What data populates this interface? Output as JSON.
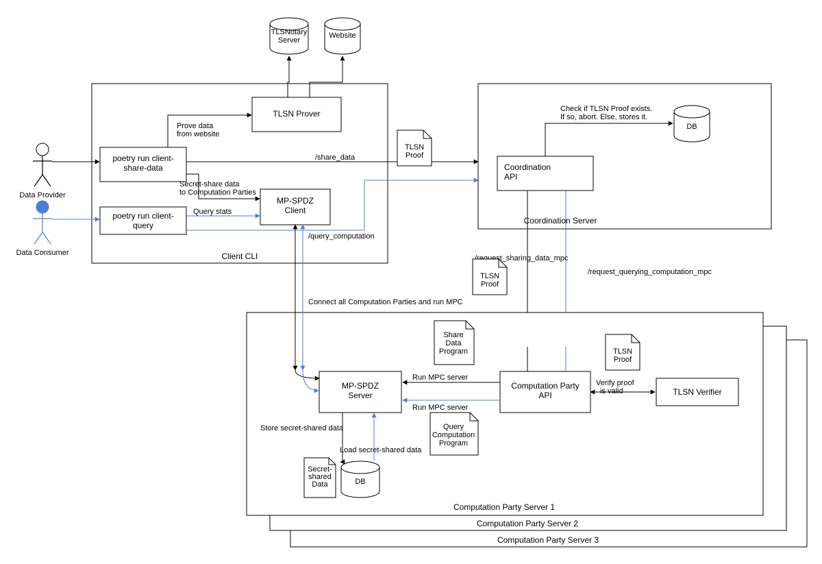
{
  "actors": {
    "data_provider": "Data Provider",
    "data_consumer": "Data Consumer"
  },
  "cylinders": {
    "tlsnotary": "TLSNotary\nServer",
    "website": "Website",
    "coord_db": "DB",
    "party_db": "DB"
  },
  "client_cli": {
    "title": "Client CLI",
    "share_data_cmd": "poetry run client-\nshare-data",
    "query_cmd": "poetry run client-\nquery",
    "tlsn_prover": "TLSN Prover",
    "mpspdz_client": "MP-SPDZ\nClient"
  },
  "coord": {
    "title": "Coordination Server",
    "api": "Coordination\nAPI",
    "check_note": "Check if TLSN Proof exists.\nIf so, abort. Else, stores it."
  },
  "party": {
    "title1": "Computation Party Server 1",
    "title2": "Computation Party Server 2",
    "title3": "Computation Party Server 3",
    "mpspdz_server": "MP-SPDZ\nServer",
    "comp_api": "Computation Party\nAPI",
    "tlsn_verifier": "TLSN Verifier"
  },
  "docs": {
    "tlsn_proof": "TLSN\nProof",
    "share_data_program": "Share\nData\nProgram",
    "query_comp_program": "Query\nComputation\nProgram",
    "secret_shared_data": "Secret-\nshared\nData"
  },
  "edge_labels": {
    "prove_data": "Prove data\nfrom website",
    "secret_share": "Secret-share data\nto Computation Parties",
    "query_stats": "Query stats",
    "share_data_ep": "/share_data",
    "query_comp_ep": "/query_computation",
    "connect_all": "Connect all Computation Parties and run MPC",
    "req_sharing": "/request_sharing_data_mpc",
    "req_querying": "/request_querying_computation_mpc",
    "run_mpc1": "Run MPC server",
    "run_mpc2": "Run MPC server",
    "verify_proof": "Verify proof\nis valid",
    "store_shared": "Store secret-shared data",
    "load_shared": "Load secret-shared data"
  }
}
